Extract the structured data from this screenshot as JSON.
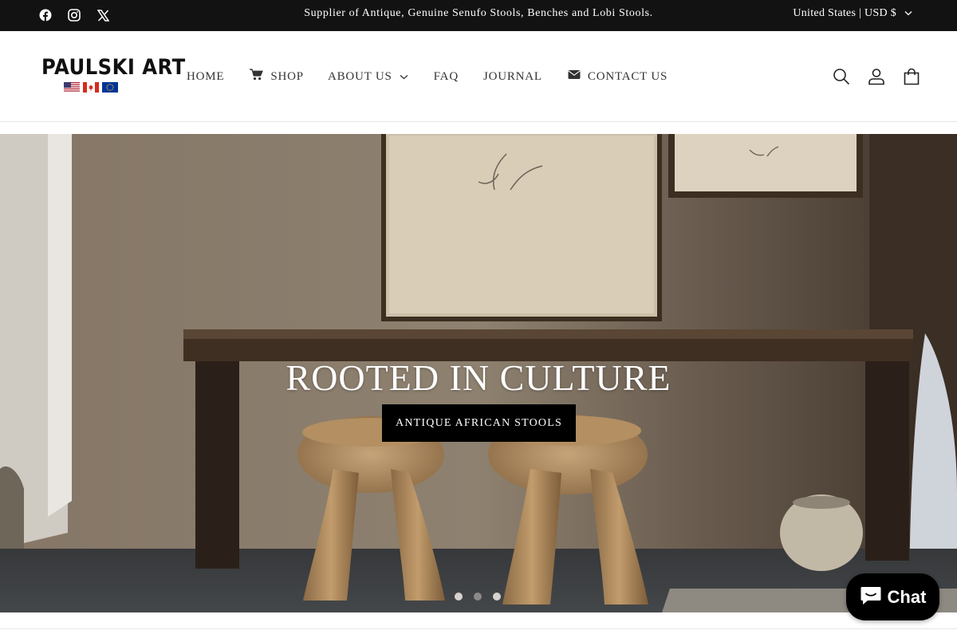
{
  "topbar": {
    "social": [
      "facebook-icon",
      "instagram-icon",
      "x-icon"
    ],
    "announcement": "Supplier of Antique, Genuine Senufo Stools, Benches and Lobi Stools.",
    "country": "United States | USD $"
  },
  "header": {
    "logo_text": "PAULSKI ART",
    "flags": [
      "usa-flag",
      "canada-flag",
      "eu-flag"
    ],
    "nav": {
      "home": "HOME",
      "shop": "SHOP",
      "about": "ABOUT US",
      "faq": "FAQ",
      "journal": "JOURNAL",
      "contact": "CONTACT US"
    },
    "icons": [
      "search-icon",
      "account-icon",
      "cart-icon"
    ]
  },
  "hero": {
    "title": "ROOTED IN CULTURE",
    "button": "ANTIQUE AFRICAN STOOLS",
    "slides": 3,
    "active_slide": 2
  },
  "chat": {
    "label": "Chat"
  },
  "colors": {
    "topbar_bg": "#121212",
    "button_bg": "#000000",
    "text": "#121212"
  }
}
